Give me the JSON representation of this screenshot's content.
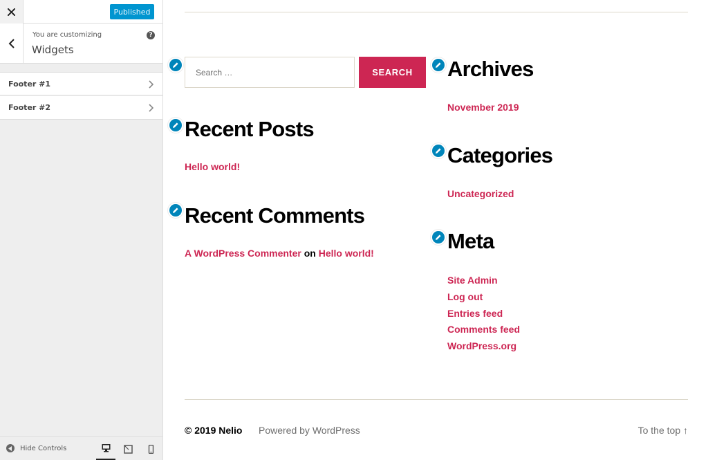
{
  "customizer": {
    "close_icon": "close-icon",
    "publish_label": "Published",
    "back_icon": "chevron-left-icon",
    "customizing_label": "You are customizing",
    "panel_title": "Widgets",
    "help_icon": "question-circle-icon",
    "help_glyph": "?",
    "sections": [
      {
        "label": "Footer #1"
      },
      {
        "label": "Footer #2"
      }
    ],
    "hide_controls_label": "Hide Controls",
    "devices": [
      "desktop",
      "tablet",
      "mobile"
    ],
    "colors": {
      "publish": "#0095d0",
      "panel_bg": "#eeeeee",
      "text": "#444444"
    }
  },
  "preview": {
    "accent_color": "#cd2653",
    "search": {
      "placeholder": "Search …",
      "button_label": "SEARCH"
    },
    "widgets": {
      "recent_posts": {
        "title": "Recent Posts",
        "items": [
          "Hello world!"
        ]
      },
      "recent_comments": {
        "title": "Recent Comments",
        "author": "A WordPress Commenter",
        "connector": "on",
        "post": "Hello world!"
      },
      "archives": {
        "title": "Archives",
        "items": [
          "November 2019"
        ]
      },
      "categories": {
        "title": "Categories",
        "items": [
          "Uncategorized"
        ]
      },
      "meta": {
        "title": "Meta",
        "items": [
          "Site Admin",
          "Log out",
          "Entries feed",
          "Comments feed",
          "WordPress.org"
        ]
      }
    },
    "footer": {
      "copyright": "© 2019 Nelio",
      "powered_by": "Powered by WordPress",
      "to_top": "To the top ↑"
    }
  }
}
